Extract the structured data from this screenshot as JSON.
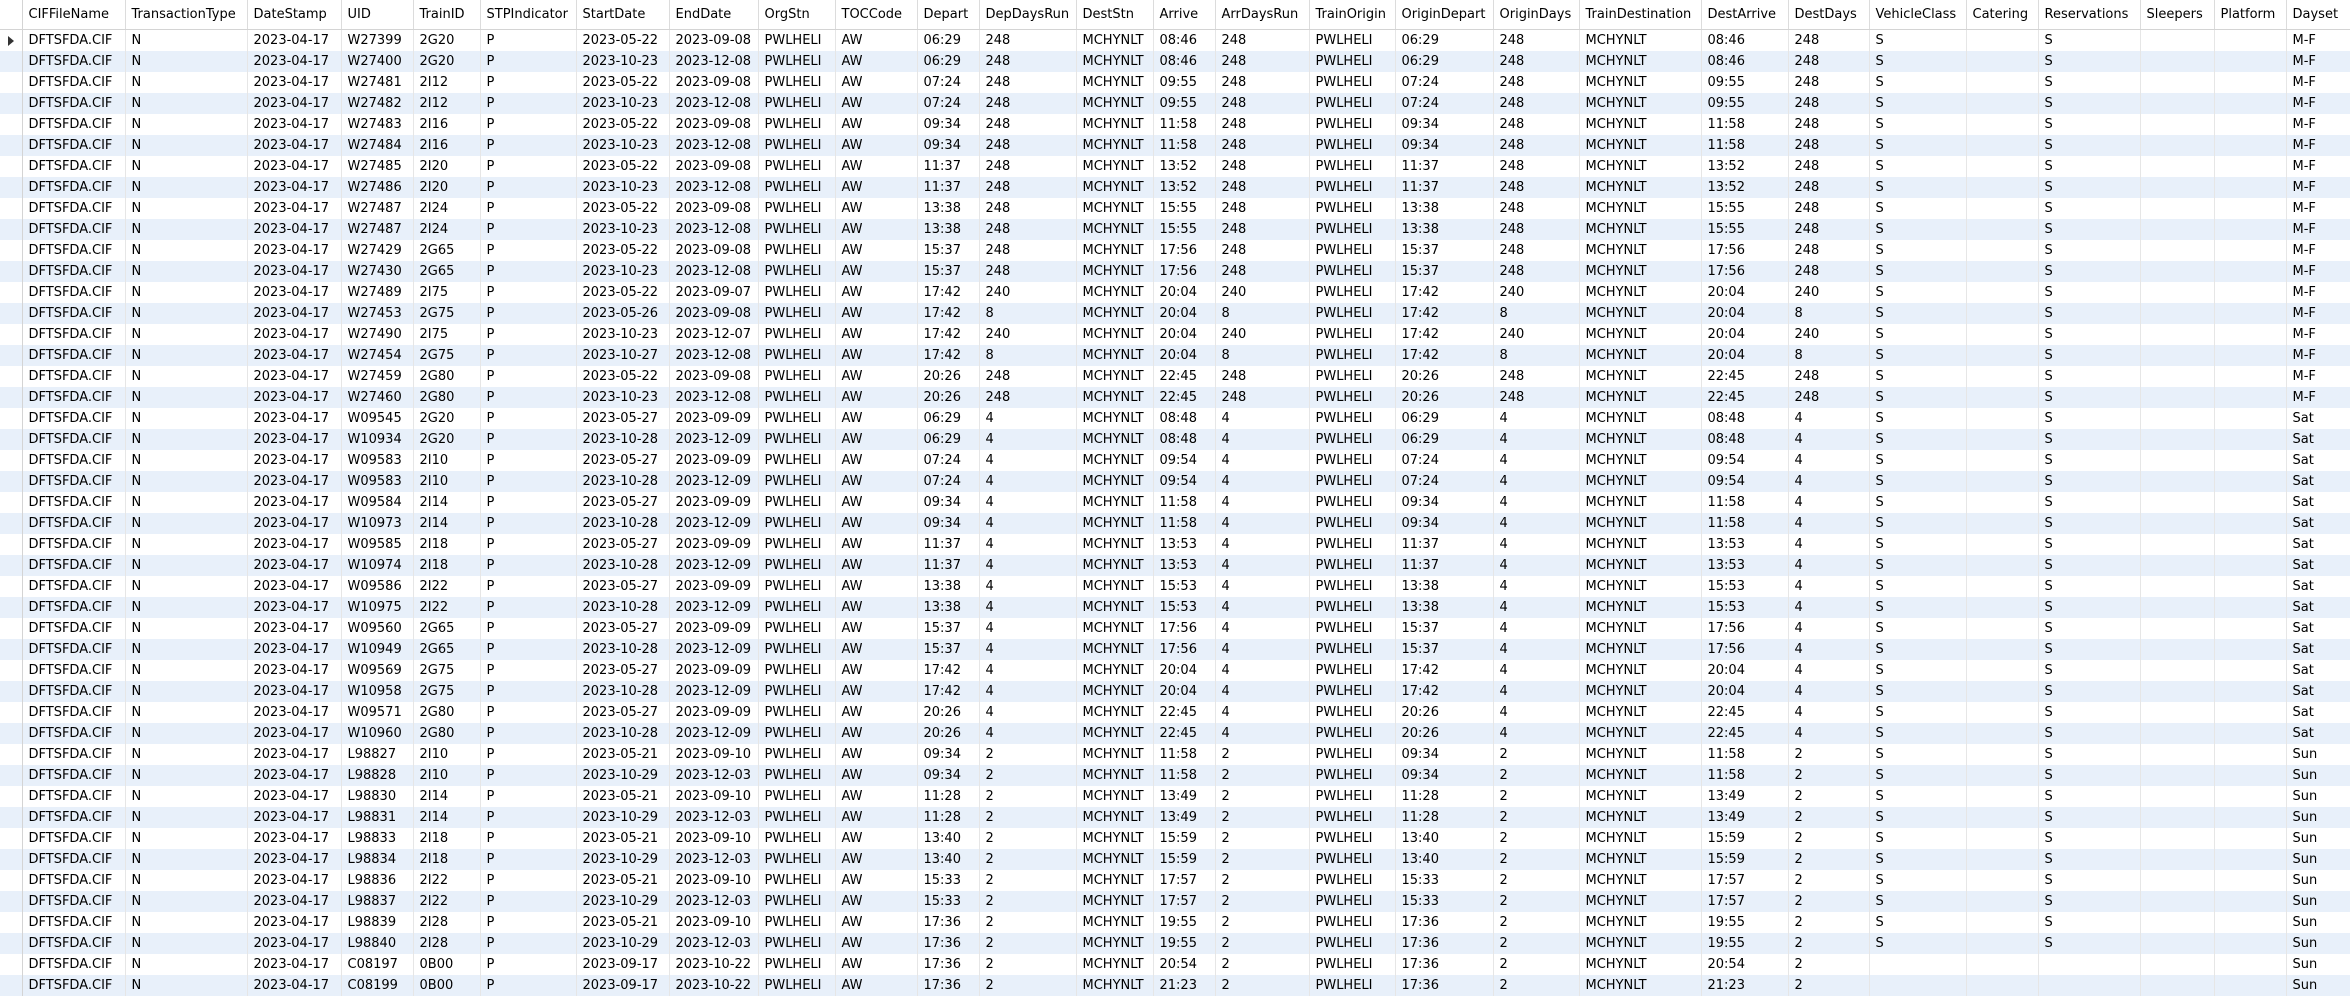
{
  "columns": [
    {
      "label": "CIFFileName",
      "w": 103
    },
    {
      "label": "TransactionType",
      "w": 122
    },
    {
      "label": "DateStamp",
      "w": 94
    },
    {
      "label": "UID",
      "w": 72
    },
    {
      "label": "TrainID",
      "w": 67
    },
    {
      "label": "STPIndicator",
      "w": 96
    },
    {
      "label": "StartDate",
      "w": 93
    },
    {
      "label": "EndDate",
      "w": 89
    },
    {
      "label": "OrgStn",
      "w": 77
    },
    {
      "label": "TOCCode",
      "w": 82
    },
    {
      "label": "Depart",
      "w": 62
    },
    {
      "label": "DepDaysRun",
      "w": 97
    },
    {
      "label": "DestStn",
      "w": 77
    },
    {
      "label": "Arrive",
      "w": 62
    },
    {
      "label": "ArrDaysRun",
      "w": 94
    },
    {
      "label": "TrainOrigin",
      "w": 86
    },
    {
      "label": "OriginDepart",
      "w": 98
    },
    {
      "label": "OriginDays",
      "w": 86
    },
    {
      "label": "TrainDestination",
      "w": 122
    },
    {
      "label": "DestArrive",
      "w": 87
    },
    {
      "label": "DestDays",
      "w": 81
    },
    {
      "label": "VehicleClass",
      "w": 97
    },
    {
      "label": "Catering",
      "w": 72
    },
    {
      "label": "Reservations",
      "w": 102
    },
    {
      "label": "Sleepers",
      "w": 74
    },
    {
      "label": "Platform",
      "w": 72
    },
    {
      "label": "Dayset",
      "w": 68
    }
  ],
  "rows": [
    [
      "DFTSFDA.CIF",
      "N",
      "2023-04-17",
      "W27399",
      "2G20",
      "P",
      "2023-05-22",
      "2023-09-08",
      "PWLHELI",
      "AW",
      "06:29",
      "248",
      "MCHYNLT",
      "08:46",
      "248",
      "PWLHELI",
      "06:29",
      "248",
      "MCHYNLT",
      "08:46",
      "248",
      "S",
      "",
      "S",
      "",
      "",
      "M-F"
    ],
    [
      "DFTSFDA.CIF",
      "N",
      "2023-04-17",
      "W27400",
      "2G20",
      "P",
      "2023-10-23",
      "2023-12-08",
      "PWLHELI",
      "AW",
      "06:29",
      "248",
      "MCHYNLT",
      "08:46",
      "248",
      "PWLHELI",
      "06:29",
      "248",
      "MCHYNLT",
      "08:46",
      "248",
      "S",
      "",
      "S",
      "",
      "",
      "M-F"
    ],
    [
      "DFTSFDA.CIF",
      "N",
      "2023-04-17",
      "W27481",
      "2I12",
      "P",
      "2023-05-22",
      "2023-09-08",
      "PWLHELI",
      "AW",
      "07:24",
      "248",
      "MCHYNLT",
      "09:55",
      "248",
      "PWLHELI",
      "07:24",
      "248",
      "MCHYNLT",
      "09:55",
      "248",
      "S",
      "",
      "S",
      "",
      "",
      "M-F"
    ],
    [
      "DFTSFDA.CIF",
      "N",
      "2023-04-17",
      "W27482",
      "2I12",
      "P",
      "2023-10-23",
      "2023-12-08",
      "PWLHELI",
      "AW",
      "07:24",
      "248",
      "MCHYNLT",
      "09:55",
      "248",
      "PWLHELI",
      "07:24",
      "248",
      "MCHYNLT",
      "09:55",
      "248",
      "S",
      "",
      "S",
      "",
      "",
      "M-F"
    ],
    [
      "DFTSFDA.CIF",
      "N",
      "2023-04-17",
      "W27483",
      "2I16",
      "P",
      "2023-05-22",
      "2023-09-08",
      "PWLHELI",
      "AW",
      "09:34",
      "248",
      "MCHYNLT",
      "11:58",
      "248",
      "PWLHELI",
      "09:34",
      "248",
      "MCHYNLT",
      "11:58",
      "248",
      "S",
      "",
      "S",
      "",
      "",
      "M-F"
    ],
    [
      "DFTSFDA.CIF",
      "N",
      "2023-04-17",
      "W27484",
      "2I16",
      "P",
      "2023-10-23",
      "2023-12-08",
      "PWLHELI",
      "AW",
      "09:34",
      "248",
      "MCHYNLT",
      "11:58",
      "248",
      "PWLHELI",
      "09:34",
      "248",
      "MCHYNLT",
      "11:58",
      "248",
      "S",
      "",
      "S",
      "",
      "",
      "M-F"
    ],
    [
      "DFTSFDA.CIF",
      "N",
      "2023-04-17",
      "W27485",
      "2I20",
      "P",
      "2023-05-22",
      "2023-09-08",
      "PWLHELI",
      "AW",
      "11:37",
      "248",
      "MCHYNLT",
      "13:52",
      "248",
      "PWLHELI",
      "11:37",
      "248",
      "MCHYNLT",
      "13:52",
      "248",
      "S",
      "",
      "S",
      "",
      "",
      "M-F"
    ],
    [
      "DFTSFDA.CIF",
      "N",
      "2023-04-17",
      "W27486",
      "2I20",
      "P",
      "2023-10-23",
      "2023-12-08",
      "PWLHELI",
      "AW",
      "11:37",
      "248",
      "MCHYNLT",
      "13:52",
      "248",
      "PWLHELI",
      "11:37",
      "248",
      "MCHYNLT",
      "13:52",
      "248",
      "S",
      "",
      "S",
      "",
      "",
      "M-F"
    ],
    [
      "DFTSFDA.CIF",
      "N",
      "2023-04-17",
      "W27487",
      "2I24",
      "P",
      "2023-05-22",
      "2023-09-08",
      "PWLHELI",
      "AW",
      "13:38",
      "248",
      "MCHYNLT",
      "15:55",
      "248",
      "PWLHELI",
      "13:38",
      "248",
      "MCHYNLT",
      "15:55",
      "248",
      "S",
      "",
      "S",
      "",
      "",
      "M-F"
    ],
    [
      "DFTSFDA.CIF",
      "N",
      "2023-04-17",
      "W27487",
      "2I24",
      "P",
      "2023-10-23",
      "2023-12-08",
      "PWLHELI",
      "AW",
      "13:38",
      "248",
      "MCHYNLT",
      "15:55",
      "248",
      "PWLHELI",
      "13:38",
      "248",
      "MCHYNLT",
      "15:55",
      "248",
      "S",
      "",
      "S",
      "",
      "",
      "M-F"
    ],
    [
      "DFTSFDA.CIF",
      "N",
      "2023-04-17",
      "W27429",
      "2G65",
      "P",
      "2023-05-22",
      "2023-09-08",
      "PWLHELI",
      "AW",
      "15:37",
      "248",
      "MCHYNLT",
      "17:56",
      "248",
      "PWLHELI",
      "15:37",
      "248",
      "MCHYNLT",
      "17:56",
      "248",
      "S",
      "",
      "S",
      "",
      "",
      "M-F"
    ],
    [
      "DFTSFDA.CIF",
      "N",
      "2023-04-17",
      "W27430",
      "2G65",
      "P",
      "2023-10-23",
      "2023-12-08",
      "PWLHELI",
      "AW",
      "15:37",
      "248",
      "MCHYNLT",
      "17:56",
      "248",
      "PWLHELI",
      "15:37",
      "248",
      "MCHYNLT",
      "17:56",
      "248",
      "S",
      "",
      "S",
      "",
      "",
      "M-F"
    ],
    [
      "DFTSFDA.CIF",
      "N",
      "2023-04-17",
      "W27489",
      "2I75",
      "P",
      "2023-05-22",
      "2023-09-07",
      "PWLHELI",
      "AW",
      "17:42",
      "240",
      "MCHYNLT",
      "20:04",
      "240",
      "PWLHELI",
      "17:42",
      "240",
      "MCHYNLT",
      "20:04",
      "240",
      "S",
      "",
      "S",
      "",
      "",
      "M-F"
    ],
    [
      "DFTSFDA.CIF",
      "N",
      "2023-04-17",
      "W27453",
      "2G75",
      "P",
      "2023-05-26",
      "2023-09-08",
      "PWLHELI",
      "AW",
      "17:42",
      "8",
      "MCHYNLT",
      "20:04",
      "8",
      "PWLHELI",
      "17:42",
      "8",
      "MCHYNLT",
      "20:04",
      "8",
      "S",
      "",
      "S",
      "",
      "",
      "M-F"
    ],
    [
      "DFTSFDA.CIF",
      "N",
      "2023-04-17",
      "W27490",
      "2I75",
      "P",
      "2023-10-23",
      "2023-12-07",
      "PWLHELI",
      "AW",
      "17:42",
      "240",
      "MCHYNLT",
      "20:04",
      "240",
      "PWLHELI",
      "17:42",
      "240",
      "MCHYNLT",
      "20:04",
      "240",
      "S",
      "",
      "S",
      "",
      "",
      "M-F"
    ],
    [
      "DFTSFDA.CIF",
      "N",
      "2023-04-17",
      "W27454",
      "2G75",
      "P",
      "2023-10-27",
      "2023-12-08",
      "PWLHELI",
      "AW",
      "17:42",
      "8",
      "MCHYNLT",
      "20:04",
      "8",
      "PWLHELI",
      "17:42",
      "8",
      "MCHYNLT",
      "20:04",
      "8",
      "S",
      "",
      "S",
      "",
      "",
      "M-F"
    ],
    [
      "DFTSFDA.CIF",
      "N",
      "2023-04-17",
      "W27459",
      "2G80",
      "P",
      "2023-05-22",
      "2023-09-08",
      "PWLHELI",
      "AW",
      "20:26",
      "248",
      "MCHYNLT",
      "22:45",
      "248",
      "PWLHELI",
      "20:26",
      "248",
      "MCHYNLT",
      "22:45",
      "248",
      "S",
      "",
      "S",
      "",
      "",
      "M-F"
    ],
    [
      "DFTSFDA.CIF",
      "N",
      "2023-04-17",
      "W27460",
      "2G80",
      "P",
      "2023-10-23",
      "2023-12-08",
      "PWLHELI",
      "AW",
      "20:26",
      "248",
      "MCHYNLT",
      "22:45",
      "248",
      "PWLHELI",
      "20:26",
      "248",
      "MCHYNLT",
      "22:45",
      "248",
      "S",
      "",
      "S",
      "",
      "",
      "M-F"
    ],
    [
      "DFTSFDA.CIF",
      "N",
      "2023-04-17",
      "W09545",
      "2G20",
      "P",
      "2023-05-27",
      "2023-09-09",
      "PWLHELI",
      "AW",
      "06:29",
      "4",
      "MCHYNLT",
      "08:48",
      "4",
      "PWLHELI",
      "06:29",
      "4",
      "MCHYNLT",
      "08:48",
      "4",
      "S",
      "",
      "S",
      "",
      "",
      "Sat"
    ],
    [
      "DFTSFDA.CIF",
      "N",
      "2023-04-17",
      "W10934",
      "2G20",
      "P",
      "2023-10-28",
      "2023-12-09",
      "PWLHELI",
      "AW",
      "06:29",
      "4",
      "MCHYNLT",
      "08:48",
      "4",
      "PWLHELI",
      "06:29",
      "4",
      "MCHYNLT",
      "08:48",
      "4",
      "S",
      "",
      "S",
      "",
      "",
      "Sat"
    ],
    [
      "DFTSFDA.CIF",
      "N",
      "2023-04-17",
      "W09583",
      "2I10",
      "P",
      "2023-05-27",
      "2023-09-09",
      "PWLHELI",
      "AW",
      "07:24",
      "4",
      "MCHYNLT",
      "09:54",
      "4",
      "PWLHELI",
      "07:24",
      "4",
      "MCHYNLT",
      "09:54",
      "4",
      "S",
      "",
      "S",
      "",
      "",
      "Sat"
    ],
    [
      "DFTSFDA.CIF",
      "N",
      "2023-04-17",
      "W09583",
      "2I10",
      "P",
      "2023-10-28",
      "2023-12-09",
      "PWLHELI",
      "AW",
      "07:24",
      "4",
      "MCHYNLT",
      "09:54",
      "4",
      "PWLHELI",
      "07:24",
      "4",
      "MCHYNLT",
      "09:54",
      "4",
      "S",
      "",
      "S",
      "",
      "",
      "Sat"
    ],
    [
      "DFTSFDA.CIF",
      "N",
      "2023-04-17",
      "W09584",
      "2I14",
      "P",
      "2023-05-27",
      "2023-09-09",
      "PWLHELI",
      "AW",
      "09:34",
      "4",
      "MCHYNLT",
      "11:58",
      "4",
      "PWLHELI",
      "09:34",
      "4",
      "MCHYNLT",
      "11:58",
      "4",
      "S",
      "",
      "S",
      "",
      "",
      "Sat"
    ],
    [
      "DFTSFDA.CIF",
      "N",
      "2023-04-17",
      "W10973",
      "2I14",
      "P",
      "2023-10-28",
      "2023-12-09",
      "PWLHELI",
      "AW",
      "09:34",
      "4",
      "MCHYNLT",
      "11:58",
      "4",
      "PWLHELI",
      "09:34",
      "4",
      "MCHYNLT",
      "11:58",
      "4",
      "S",
      "",
      "S",
      "",
      "",
      "Sat"
    ],
    [
      "DFTSFDA.CIF",
      "N",
      "2023-04-17",
      "W09585",
      "2I18",
      "P",
      "2023-05-27",
      "2023-09-09",
      "PWLHELI",
      "AW",
      "11:37",
      "4",
      "MCHYNLT",
      "13:53",
      "4",
      "PWLHELI",
      "11:37",
      "4",
      "MCHYNLT",
      "13:53",
      "4",
      "S",
      "",
      "S",
      "",
      "",
      "Sat"
    ],
    [
      "DFTSFDA.CIF",
      "N",
      "2023-04-17",
      "W10974",
      "2I18",
      "P",
      "2023-10-28",
      "2023-12-09",
      "PWLHELI",
      "AW",
      "11:37",
      "4",
      "MCHYNLT",
      "13:53",
      "4",
      "PWLHELI",
      "11:37",
      "4",
      "MCHYNLT",
      "13:53",
      "4",
      "S",
      "",
      "S",
      "",
      "",
      "Sat"
    ],
    [
      "DFTSFDA.CIF",
      "N",
      "2023-04-17",
      "W09586",
      "2I22",
      "P",
      "2023-05-27",
      "2023-09-09",
      "PWLHELI",
      "AW",
      "13:38",
      "4",
      "MCHYNLT",
      "15:53",
      "4",
      "PWLHELI",
      "13:38",
      "4",
      "MCHYNLT",
      "15:53",
      "4",
      "S",
      "",
      "S",
      "",
      "",
      "Sat"
    ],
    [
      "DFTSFDA.CIF",
      "N",
      "2023-04-17",
      "W10975",
      "2I22",
      "P",
      "2023-10-28",
      "2023-12-09",
      "PWLHELI",
      "AW",
      "13:38",
      "4",
      "MCHYNLT",
      "15:53",
      "4",
      "PWLHELI",
      "13:38",
      "4",
      "MCHYNLT",
      "15:53",
      "4",
      "S",
      "",
      "S",
      "",
      "",
      "Sat"
    ],
    [
      "DFTSFDA.CIF",
      "N",
      "2023-04-17",
      "W09560",
      "2G65",
      "P",
      "2023-05-27",
      "2023-09-09",
      "PWLHELI",
      "AW",
      "15:37",
      "4",
      "MCHYNLT",
      "17:56",
      "4",
      "PWLHELI",
      "15:37",
      "4",
      "MCHYNLT",
      "17:56",
      "4",
      "S",
      "",
      "S",
      "",
      "",
      "Sat"
    ],
    [
      "DFTSFDA.CIF",
      "N",
      "2023-04-17",
      "W10949",
      "2G65",
      "P",
      "2023-10-28",
      "2023-12-09",
      "PWLHELI",
      "AW",
      "15:37",
      "4",
      "MCHYNLT",
      "17:56",
      "4",
      "PWLHELI",
      "15:37",
      "4",
      "MCHYNLT",
      "17:56",
      "4",
      "S",
      "",
      "S",
      "",
      "",
      "Sat"
    ],
    [
      "DFTSFDA.CIF",
      "N",
      "2023-04-17",
      "W09569",
      "2G75",
      "P",
      "2023-05-27",
      "2023-09-09",
      "PWLHELI",
      "AW",
      "17:42",
      "4",
      "MCHYNLT",
      "20:04",
      "4",
      "PWLHELI",
      "17:42",
      "4",
      "MCHYNLT",
      "20:04",
      "4",
      "S",
      "",
      "S",
      "",
      "",
      "Sat"
    ],
    [
      "DFTSFDA.CIF",
      "N",
      "2023-04-17",
      "W10958",
      "2G75",
      "P",
      "2023-10-28",
      "2023-12-09",
      "PWLHELI",
      "AW",
      "17:42",
      "4",
      "MCHYNLT",
      "20:04",
      "4",
      "PWLHELI",
      "17:42",
      "4",
      "MCHYNLT",
      "20:04",
      "4",
      "S",
      "",
      "S",
      "",
      "",
      "Sat"
    ],
    [
      "DFTSFDA.CIF",
      "N",
      "2023-04-17",
      "W09571",
      "2G80",
      "P",
      "2023-05-27",
      "2023-09-09",
      "PWLHELI",
      "AW",
      "20:26",
      "4",
      "MCHYNLT",
      "22:45",
      "4",
      "PWLHELI",
      "20:26",
      "4",
      "MCHYNLT",
      "22:45",
      "4",
      "S",
      "",
      "S",
      "",
      "",
      "Sat"
    ],
    [
      "DFTSFDA.CIF",
      "N",
      "2023-04-17",
      "W10960",
      "2G80",
      "P",
      "2023-10-28",
      "2023-12-09",
      "PWLHELI",
      "AW",
      "20:26",
      "4",
      "MCHYNLT",
      "22:45",
      "4",
      "PWLHELI",
      "20:26",
      "4",
      "MCHYNLT",
      "22:45",
      "4",
      "S",
      "",
      "S",
      "",
      "",
      "Sat"
    ],
    [
      "DFTSFDA.CIF",
      "N",
      "2023-04-17",
      "L98827",
      "2I10",
      "P",
      "2023-05-21",
      "2023-09-10",
      "PWLHELI",
      "AW",
      "09:34",
      "2",
      "MCHYNLT",
      "11:58",
      "2",
      "PWLHELI",
      "09:34",
      "2",
      "MCHYNLT",
      "11:58",
      "2",
      "S",
      "",
      "S",
      "",
      "",
      "Sun"
    ],
    [
      "DFTSFDA.CIF",
      "N",
      "2023-04-17",
      "L98828",
      "2I10",
      "P",
      "2023-10-29",
      "2023-12-03",
      "PWLHELI",
      "AW",
      "09:34",
      "2",
      "MCHYNLT",
      "11:58",
      "2",
      "PWLHELI",
      "09:34",
      "2",
      "MCHYNLT",
      "11:58",
      "2",
      "S",
      "",
      "S",
      "",
      "",
      "Sun"
    ],
    [
      "DFTSFDA.CIF",
      "N",
      "2023-04-17",
      "L98830",
      "2I14",
      "P",
      "2023-05-21",
      "2023-09-10",
      "PWLHELI",
      "AW",
      "11:28",
      "2",
      "MCHYNLT",
      "13:49",
      "2",
      "PWLHELI",
      "11:28",
      "2",
      "MCHYNLT",
      "13:49",
      "2",
      "S",
      "",
      "S",
      "",
      "",
      "Sun"
    ],
    [
      "DFTSFDA.CIF",
      "N",
      "2023-04-17",
      "L98831",
      "2I14",
      "P",
      "2023-10-29",
      "2023-12-03",
      "PWLHELI",
      "AW",
      "11:28",
      "2",
      "MCHYNLT",
      "13:49",
      "2",
      "PWLHELI",
      "11:28",
      "2",
      "MCHYNLT",
      "13:49",
      "2",
      "S",
      "",
      "S",
      "",
      "",
      "Sun"
    ],
    [
      "DFTSFDA.CIF",
      "N",
      "2023-04-17",
      "L98833",
      "2I18",
      "P",
      "2023-05-21",
      "2023-09-10",
      "PWLHELI",
      "AW",
      "13:40",
      "2",
      "MCHYNLT",
      "15:59",
      "2",
      "PWLHELI",
      "13:40",
      "2",
      "MCHYNLT",
      "15:59",
      "2",
      "S",
      "",
      "S",
      "",
      "",
      "Sun"
    ],
    [
      "DFTSFDA.CIF",
      "N",
      "2023-04-17",
      "L98834",
      "2I18",
      "P",
      "2023-10-29",
      "2023-12-03",
      "PWLHELI",
      "AW",
      "13:40",
      "2",
      "MCHYNLT",
      "15:59",
      "2",
      "PWLHELI",
      "13:40",
      "2",
      "MCHYNLT",
      "15:59",
      "2",
      "S",
      "",
      "S",
      "",
      "",
      "Sun"
    ],
    [
      "DFTSFDA.CIF",
      "N",
      "2023-04-17",
      "L98836",
      "2I22",
      "P",
      "2023-05-21",
      "2023-09-10",
      "PWLHELI",
      "AW",
      "15:33",
      "2",
      "MCHYNLT",
      "17:57",
      "2",
      "PWLHELI",
      "15:33",
      "2",
      "MCHYNLT",
      "17:57",
      "2",
      "S",
      "",
      "S",
      "",
      "",
      "Sun"
    ],
    [
      "DFTSFDA.CIF",
      "N",
      "2023-04-17",
      "L98837",
      "2I22",
      "P",
      "2023-10-29",
      "2023-12-03",
      "PWLHELI",
      "AW",
      "15:33",
      "2",
      "MCHYNLT",
      "17:57",
      "2",
      "PWLHELI",
      "15:33",
      "2",
      "MCHYNLT",
      "17:57",
      "2",
      "S",
      "",
      "S",
      "",
      "",
      "Sun"
    ],
    [
      "DFTSFDA.CIF",
      "N",
      "2023-04-17",
      "L98839",
      "2I28",
      "P",
      "2023-05-21",
      "2023-09-10",
      "PWLHELI",
      "AW",
      "17:36",
      "2",
      "MCHYNLT",
      "19:55",
      "2",
      "PWLHELI",
      "17:36",
      "2",
      "MCHYNLT",
      "19:55",
      "2",
      "S",
      "",
      "S",
      "",
      "",
      "Sun"
    ],
    [
      "DFTSFDA.CIF",
      "N",
      "2023-04-17",
      "L98840",
      "2I28",
      "P",
      "2023-10-29",
      "2023-12-03",
      "PWLHELI",
      "AW",
      "17:36",
      "2",
      "MCHYNLT",
      "19:55",
      "2",
      "PWLHELI",
      "17:36",
      "2",
      "MCHYNLT",
      "19:55",
      "2",
      "S",
      "",
      "S",
      "",
      "",
      "Sun"
    ],
    [
      "DFTSFDA.CIF",
      "N",
      "2023-04-17",
      "C08197",
      "0B00",
      "P",
      "2023-09-17",
      "2023-10-22",
      "PWLHELI",
      "AW",
      "17:36",
      "2",
      "MCHYNLT",
      "20:54",
      "2",
      "PWLHELI",
      "17:36",
      "2",
      "MCHYNLT",
      "20:54",
      "2",
      "",
      "",
      "",
      "",
      "",
      "Sun"
    ],
    [
      "DFTSFDA.CIF",
      "N",
      "2023-04-17",
      "C08199",
      "0B00",
      "P",
      "2023-09-17",
      "2023-10-22",
      "PWLHELI",
      "AW",
      "17:36",
      "2",
      "MCHYNLT",
      "21:23",
      "2",
      "PWLHELI",
      "17:36",
      "2",
      "MCHYNLT",
      "21:23",
      "2",
      "",
      "",
      "",
      "",
      "",
      "Sun"
    ]
  ],
  "current_row_index": 0,
  "colors": {
    "alt_row": "#e8f0fa",
    "grid_line": "#e6e6e6",
    "header_border": "#d4d4d4"
  },
  "indicator_icon": "current-row-arrow-icon"
}
